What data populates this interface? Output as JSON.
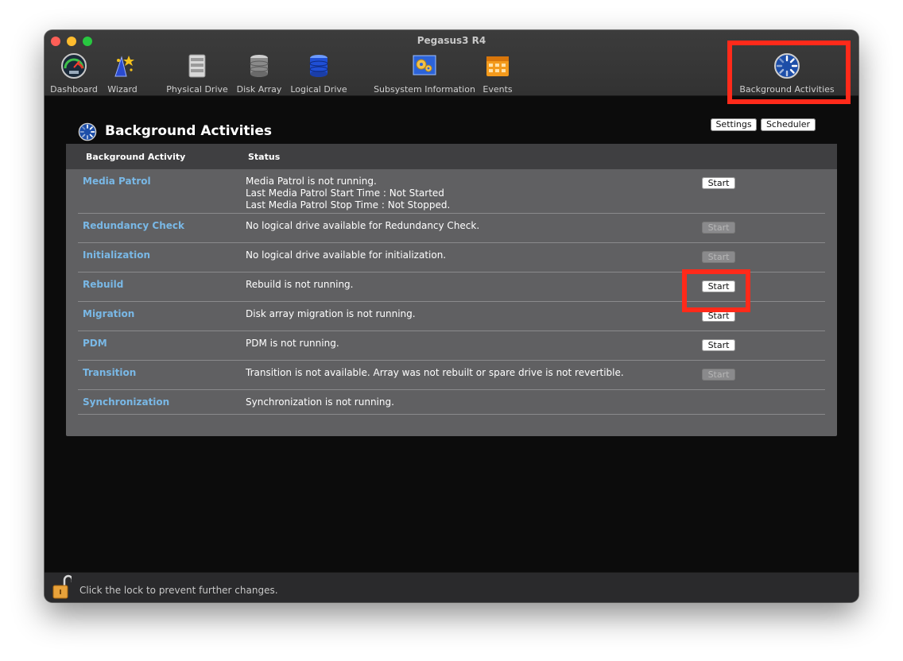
{
  "window": {
    "title": "Pegasus3 R4"
  },
  "toolbar": {
    "items": [
      {
        "label": "Dashboard",
        "icon": "dashboard-gauge-icon"
      },
      {
        "label": "Wizard",
        "icon": "wizard-hat-icon"
      },
      {
        "label": "Physical Drive",
        "icon": "physical-drive-icon"
      },
      {
        "label": "Disk Array",
        "icon": "disk-array-icon"
      },
      {
        "label": "Logical Drive",
        "icon": "logical-drive-icon"
      },
      {
        "label": "Subsystem Information",
        "icon": "subsystem-information-icon"
      },
      {
        "label": "Events",
        "icon": "events-calendar-icon"
      },
      {
        "label": "Background Activities",
        "icon": "background-activities-icon"
      }
    ]
  },
  "page": {
    "title": "Background Activities",
    "settings_label": "Settings",
    "scheduler_label": "Scheduler"
  },
  "table": {
    "headers": [
      "Background Activity",
      "Status"
    ],
    "rows": [
      {
        "name": "Media Patrol",
        "status": [
          "Media Patrol is not running.",
          "Last Media Patrol Start Time : Not Started",
          "Last Media Patrol Stop Time : Not Stopped."
        ],
        "button": "Start",
        "enabled": true
      },
      {
        "name": "Redundancy Check",
        "status": [
          "No logical drive available for Redundancy Check."
        ],
        "button": "Start",
        "enabled": false
      },
      {
        "name": "Initialization",
        "status": [
          "No logical drive available for initialization."
        ],
        "button": "Start",
        "enabled": false
      },
      {
        "name": "Rebuild",
        "status": [
          "Rebuild is not running."
        ],
        "button": "Start",
        "enabled": true
      },
      {
        "name": "Migration",
        "status": [
          "Disk array migration is not running."
        ],
        "button": "Start",
        "enabled": true
      },
      {
        "name": "PDM",
        "status": [
          "PDM is not running."
        ],
        "button": "Start",
        "enabled": true
      },
      {
        "name": "Transition",
        "status": [
          "Transition is not available. Array was not rebuilt or spare drive is not revertible."
        ],
        "button": "Start",
        "enabled": false
      },
      {
        "name": "Synchronization",
        "status": [
          "Synchronization is not running."
        ]
      }
    ]
  },
  "footer": {
    "lock_text": "Click the lock to prevent further changes."
  },
  "colors": {
    "highlight": "#ff2a1a",
    "link": "#79b8e6"
  }
}
